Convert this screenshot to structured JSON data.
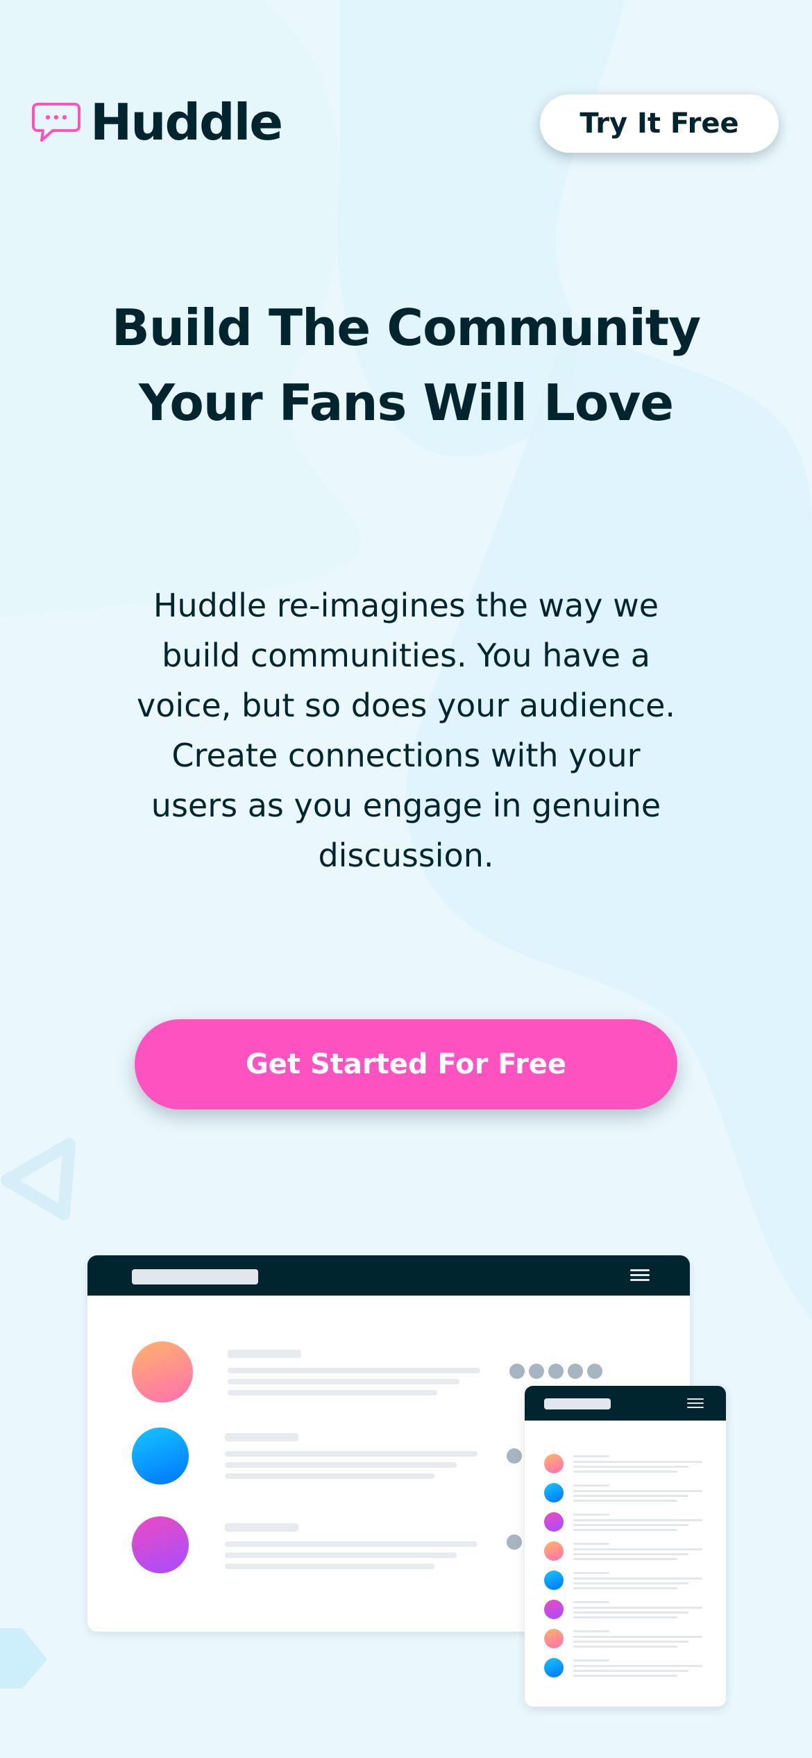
{
  "brand": {
    "name": "Huddle",
    "logo_icon": "speech-bubble-icon",
    "accent_color": "#ff52c1",
    "dark_color": "#00252e"
  },
  "header": {
    "try_button_label": "Try It Free"
  },
  "hero": {
    "headline_line1": "Build The Community",
    "headline_line2": "Your Fans Will Love",
    "description_lines": [
      "Huddle re-imagines the way we",
      "build communities. You have a",
      "voice, but so does your audience.",
      "Create connections with your",
      "users as you engage in genuine",
      "discussion."
    ],
    "cta_label": "Get Started For Free"
  },
  "illustration": {
    "menu_icon": "hamburger-menu-icon",
    "desktop_rows": 3,
    "phone_rows": 8
  }
}
